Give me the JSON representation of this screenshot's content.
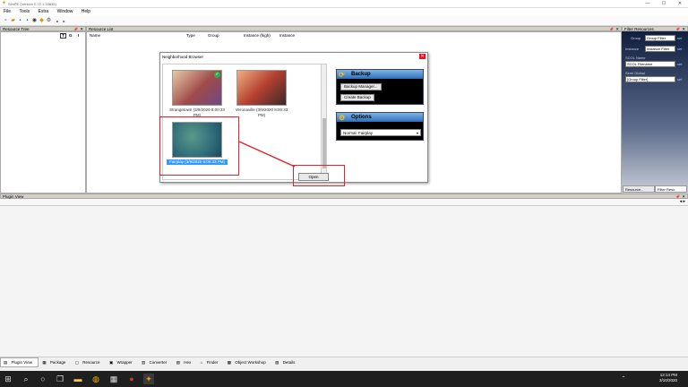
{
  "window": {
    "title": "SimPE (Version 0.72.1.33835)"
  },
  "menu": [
    "File",
    "Tools",
    "Extra",
    "Window",
    "Help"
  ],
  "panels": {
    "resource_tree": "Resource Tree",
    "resource_list": "Resource List",
    "filter_resources": "Filter Resources",
    "plugin_view": "Plugin View"
  },
  "resource_tree_buttons": [
    "T",
    "G",
    "I"
  ],
  "resource_list_columns": [
    "Name",
    "Type",
    "Group",
    "Instance (high)",
    "Instance"
  ],
  "filter": {
    "group_label": "Group",
    "group_value": "Group Filter",
    "instance_label": "Instance",
    "instance_value": "Instance Filter",
    "set_label": "set",
    "scol_label": "SCOL Name",
    "scol_value": "SCOL Filename",
    "semi_label": "Semi Global",
    "semi_value": "[Group Filter]",
    "tab_resource": "Resource...",
    "tab_filter": "Filter Reso"
  },
  "dialog": {
    "title": "Neighborhood Browser",
    "items": [
      {
        "name": "Strangetown (3/9/2020 8:00:33 PM)"
      },
      {
        "name": "Veronaville (3/9/2020 8:00:33 PM)"
      },
      {
        "name": "Fairplay (3/9/2020 8:00:33 PM)"
      }
    ],
    "backup": {
      "title": "Backup",
      "manager_button": "Backup Manager...",
      "create_button": "Create Backup"
    },
    "options": {
      "title": "Options",
      "selected": "Normal: Fairplay"
    },
    "open_button": "Open"
  },
  "bottom_tabs": [
    "Plugin View",
    "Package",
    "Resource",
    "Wrapper",
    "Converter",
    "Hex",
    "Finder",
    "Object Workshop",
    "Details"
  ],
  "taskbar": {
    "time": "12:14 PM",
    "date": "3/10/2020"
  },
  "colors": {
    "highlight": "#d9262c",
    "selection": "#3399ff",
    "sidebox_header": "#2f6fb8"
  }
}
